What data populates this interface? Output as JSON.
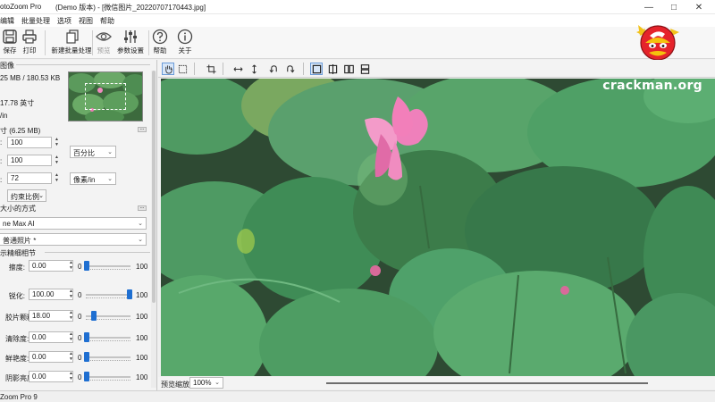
{
  "window": {
    "app_title": "otoZoom Pro",
    "doc_title": "(Demo 版本) - [微信图片_20220707170443.jpg]",
    "controls": [
      "—",
      "□",
      "✕"
    ]
  },
  "menu": [
    "编辑",
    "批量处理",
    "选项",
    "视图",
    "帮助"
  ],
  "toolbar": {
    "buttons": [
      {
        "label": "保存",
        "icon": "save-icon"
      },
      {
        "label": "打印",
        "icon": "print-icon"
      },
      {
        "label": "新建批量处理",
        "icon": "batch-icon"
      },
      {
        "label": "预览",
        "icon": "eye-icon",
        "disabled": true
      },
      {
        "label": "参数设置",
        "icon": "sliders-icon"
      },
      {
        "label": "帮助",
        "icon": "help-icon"
      },
      {
        "label": "关于",
        "icon": "info-icon"
      }
    ]
  },
  "left": {
    "source_title": "图像",
    "file_size": "25 MB / 180.53 KB",
    "dims": "17.78 英寸",
    "res_unit": "/in",
    "resize_title": "寸 (6.25 MB)",
    "width_value": "100",
    "height_value": "100",
    "res_value": "72",
    "unit_percent": "百分比",
    "unit_res": "像素/in",
    "constrain": "约束比例",
    "method_title": "大小的方式",
    "method_value": "ne Max AI",
    "preset_value": "普通照片 *",
    "fine_title": "示精细相节",
    "sliders": [
      {
        "label": "擦度:",
        "value": "0.00",
        "min": "0",
        "max": "100",
        "pos": 0.02
      },
      {
        "label": "锐化:",
        "value": "100.00",
        "min": "0",
        "max": "100",
        "pos": 0.98
      },
      {
        "label": "胶片颗粒:",
        "value": "18.00",
        "min": "0",
        "max": "100",
        "pos": 0.18
      },
      {
        "label": "清除度:",
        "value": "0.00",
        "min": "0",
        "max": "100",
        "pos": 0.02
      },
      {
        "label": "鲜艳度:",
        "value": "0.00",
        "min": "0",
        "max": "100",
        "pos": 0.02
      },
      {
        "label": "阴影亮度:",
        "value": "0.00",
        "min": "0",
        "max": "100",
        "pos": 0.02
      }
    ]
  },
  "viewbar": {
    "tools": [
      "hand-icon",
      "marquee-icon",
      "crop-icon",
      "flip-horizontal-icon",
      "flip-vertical-icon",
      "rotate-left-icon",
      "rotate-right-icon",
      "single-view-icon",
      "split-vertical-icon",
      "side-by-side-icon",
      "split-horizontal-icon"
    ]
  },
  "watermark": "crackman.org",
  "zoom": {
    "label": "预览缩放:",
    "value": "100%"
  },
  "status": "Zoom Pro 9",
  "colors": {
    "accent": "#1f6fd1",
    "pink": "#f08cc0"
  }
}
